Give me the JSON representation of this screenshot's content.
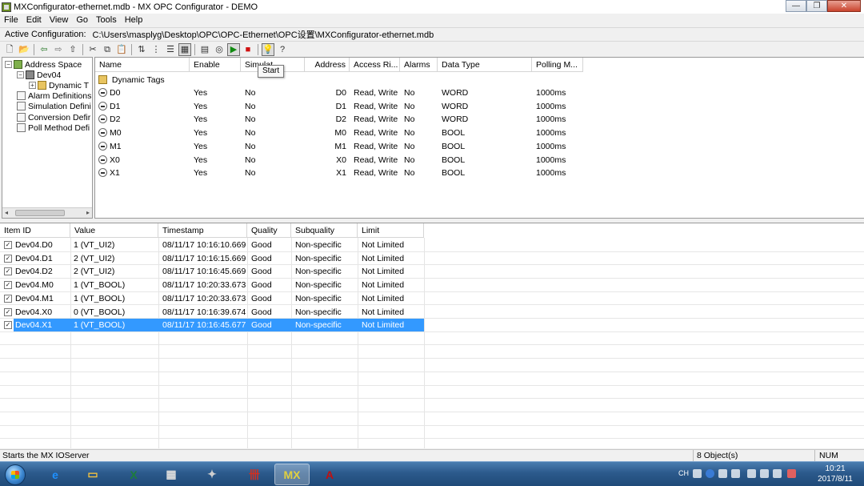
{
  "window": {
    "title": "MXConfigurator-ethernet.mdb - MX OPC Configurator - DEMO",
    "minimize": "—",
    "restore": "❐",
    "close": "✕"
  },
  "menu": [
    "File",
    "Edit",
    "View",
    "Go",
    "Tools",
    "Help"
  ],
  "config": {
    "label": "Active Configuration:",
    "path": "C:\\Users\\masplyg\\Desktop\\OPC\\OPC-Ethernet\\OPC设置\\MXConfigurator-ethernet.mdb"
  },
  "toolbar": {
    "tooltip": "Start",
    "buttons": [
      "new-icon",
      "open-icon",
      "back-icon",
      "forward-icon",
      "up-folder-icon",
      "cut-icon",
      "copy-icon",
      "paste-icon",
      "sort-icon",
      "tree-icon",
      "details-view-icon",
      "list-view-icon",
      "import-icon",
      "monitor-icon",
      "start-icon",
      "stop-icon",
      "bulb-icon",
      "help-icon"
    ]
  },
  "tree": {
    "items": [
      {
        "label": "Address Space",
        "icon": "network-icon",
        "level": 0,
        "expander": "−"
      },
      {
        "label": "Dev04",
        "icon": "device-icon",
        "level": 1,
        "expander": "−"
      },
      {
        "label": "Dynamic T",
        "icon": "folder-icon",
        "level": 2,
        "expander": "+"
      },
      {
        "label": "Alarm Definitions",
        "icon": "alarm-icon",
        "level": 0
      },
      {
        "label": "Simulation Defini",
        "icon": "simulation-icon",
        "level": 0
      },
      {
        "label": "Conversion Defir",
        "icon": "conversion-icon",
        "level": 0
      },
      {
        "label": "Poll Method Defi",
        "icon": "poll-icon",
        "level": 0
      }
    ]
  },
  "tags": {
    "columns": [
      "Name",
      "Enable",
      "Simulat",
      "Address",
      "Access Ri...",
      "Alarms",
      "Data Type",
      "Polling M..."
    ],
    "group": "Dynamic Tags",
    "rows": [
      {
        "name": "D0",
        "enable": "Yes",
        "simulate": "No",
        "address": "D0",
        "access": "Read, Write",
        "alarms": "No",
        "type": "WORD",
        "polling": "1000ms"
      },
      {
        "name": "D1",
        "enable": "Yes",
        "simulate": "No",
        "address": "D1",
        "access": "Read, Write",
        "alarms": "No",
        "type": "WORD",
        "polling": "1000ms"
      },
      {
        "name": "D2",
        "enable": "Yes",
        "simulate": "No",
        "address": "D2",
        "access": "Read, Write",
        "alarms": "No",
        "type": "WORD",
        "polling": "1000ms"
      },
      {
        "name": "M0",
        "enable": "Yes",
        "simulate": "No",
        "address": "M0",
        "access": "Read, Write",
        "alarms": "No",
        "type": "BOOL",
        "polling": "1000ms"
      },
      {
        "name": "M1",
        "enable": "Yes",
        "simulate": "No",
        "address": "M1",
        "access": "Read, Write",
        "alarms": "No",
        "type": "BOOL",
        "polling": "1000ms"
      },
      {
        "name": "X0",
        "enable": "Yes",
        "simulate": "No",
        "address": "X0",
        "access": "Read, Write",
        "alarms": "No",
        "type": "BOOL",
        "polling": "1000ms"
      },
      {
        "name": "X1",
        "enable": "Yes",
        "simulate": "No",
        "address": "X1",
        "access": "Read, Write",
        "alarms": "No",
        "type": "BOOL",
        "polling": "1000ms"
      }
    ]
  },
  "monitor": {
    "columns": [
      "Item ID",
      "Value",
      "Timestamp",
      "Quality",
      "Subquality",
      "Limit"
    ],
    "selected_index": 6,
    "rows": [
      {
        "id": "Dev04.D0",
        "value": "1 (VT_UI2)",
        "ts": "08/11/17 10:16:10.669",
        "quality": "Good",
        "sub": "Non-specific",
        "limit": "Not Limited"
      },
      {
        "id": "Dev04.D1",
        "value": "2 (VT_UI2)",
        "ts": "08/11/17 10:16:15.669",
        "quality": "Good",
        "sub": "Non-specific",
        "limit": "Not Limited"
      },
      {
        "id": "Dev04.D2",
        "value": "2 (VT_UI2)",
        "ts": "08/11/17 10:16:45.669",
        "quality": "Good",
        "sub": "Non-specific",
        "limit": "Not Limited"
      },
      {
        "id": "Dev04.M0",
        "value": "1 (VT_BOOL)",
        "ts": "08/11/17 10:20:33.673",
        "quality": "Good",
        "sub": "Non-specific",
        "limit": "Not Limited"
      },
      {
        "id": "Dev04.M1",
        "value": "1 (VT_BOOL)",
        "ts": "08/11/17 10:20:33.673",
        "quality": "Good",
        "sub": "Non-specific",
        "limit": "Not Limited"
      },
      {
        "id": "Dev04.X0",
        "value": "0 (VT_BOOL)",
        "ts": "08/11/17 10:16:39.674",
        "quality": "Good",
        "sub": "Non-specific",
        "limit": "Not Limited"
      },
      {
        "id": "Dev04.X1",
        "value": "1 (VT_BOOL)",
        "ts": "08/11/17 10:16:45.677",
        "quality": "Good",
        "sub": "Non-specific",
        "limit": "Not Limited"
      }
    ]
  },
  "status": {
    "message": "Starts the MX IOServer",
    "objects": "8 Object(s)",
    "num": "NUM"
  },
  "taskbar": {
    "apps": [
      {
        "name": "ie-icon",
        "glyph": "e",
        "color": "#1e90ff"
      },
      {
        "name": "explorer-icon",
        "glyph": "▭",
        "color": "#f0c040"
      },
      {
        "name": "excel-icon",
        "glyph": "X",
        "color": "#1d7d3a"
      },
      {
        "name": "calculator-icon",
        "glyph": "▦",
        "color": "#dddddd"
      },
      {
        "name": "tool-icon",
        "glyph": "✦",
        "color": "#cfcfcf"
      },
      {
        "name": "plc-icon",
        "glyph": "卌",
        "color": "#d03020"
      },
      {
        "name": "mxopc-icon",
        "glyph": "MX",
        "color": "#e0d040"
      },
      {
        "name": "acrobat-icon",
        "glyph": "A",
        "color": "#c01010"
      }
    ],
    "lang": "CH",
    "time": "10:21",
    "date": "2017/8/11"
  },
  "colors": {
    "selection": "#3399ff",
    "start_green": "#118a11",
    "stop_red": "#d01010"
  }
}
